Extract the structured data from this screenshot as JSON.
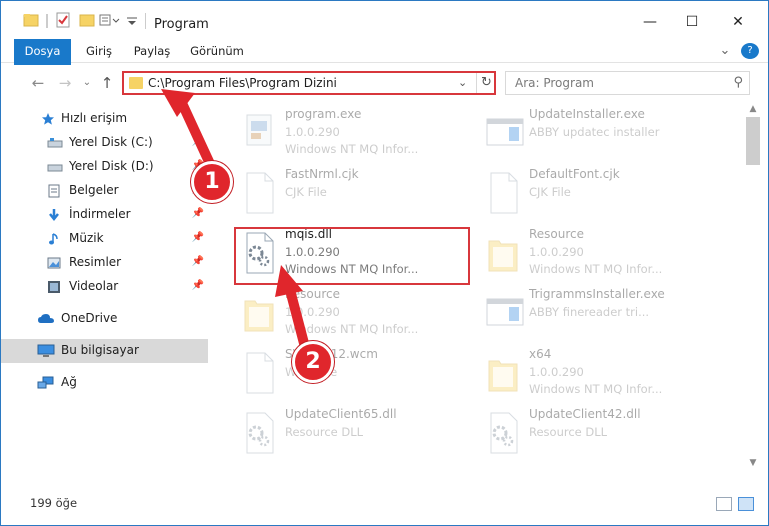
{
  "window": {
    "title": "Program",
    "controls": {
      "minimize": "—",
      "maximize": "☐",
      "close": "✕"
    }
  },
  "ribbon": {
    "tabs": [
      "Dosya",
      "Giriş",
      "Paylaş",
      "Görünüm"
    ],
    "collapse_icon": "⌄",
    "help_icon": "?"
  },
  "address": {
    "path": "C:\\Program Files\\Program Dizini",
    "search_placeholder": "Ara: Program"
  },
  "sidebar": {
    "items": [
      {
        "label": "Hızlı erişim",
        "icon": "star-icon",
        "pinned": false
      },
      {
        "label": "Yerel Disk (C:)",
        "icon": "drive-icon",
        "pinned": true
      },
      {
        "label": "Yerel Disk (D:)",
        "icon": "drive-icon",
        "pinned": true
      },
      {
        "label": "Belgeler",
        "icon": "documents-icon",
        "pinned": true
      },
      {
        "label": "İndirmeler",
        "icon": "download-icon",
        "pinned": true
      },
      {
        "label": "Müzik",
        "icon": "music-icon",
        "pinned": true
      },
      {
        "label": "Resimler",
        "icon": "pictures-icon",
        "pinned": true
      },
      {
        "label": "Videolar",
        "icon": "videos-icon",
        "pinned": true
      },
      {
        "label": "OneDrive",
        "icon": "cloud-icon",
        "pinned": false
      },
      {
        "label": "Bu bilgisayar",
        "icon": "computer-icon",
        "pinned": false
      },
      {
        "label": "Ağ",
        "icon": "network-icon",
        "pinned": false
      }
    ]
  },
  "files": [
    {
      "name": "program.exe",
      "l2": "1.0.0.290",
      "l3": "Windows NT MQ Infor...",
      "icon": "exe-icon"
    },
    {
      "name": "UpdateInstaller.exe",
      "l2": "ABBY updatec installer",
      "l3": "",
      "icon": "window-icon"
    },
    {
      "name": "FastNrml.cjk",
      "l2": "CJK File",
      "l3": "",
      "icon": "blank-file-icon"
    },
    {
      "name": "DefaultFont.cjk",
      "l2": "CJK File",
      "l3": "",
      "icon": "blank-file-icon"
    },
    {
      "name": "mqis.dll",
      "l2": "1.0.0.290",
      "l3": "Windows NT MQ Infor...",
      "icon": "dll-gear-icon"
    },
    {
      "name": "Resource",
      "l2": "1.0.0.290",
      "l3": "Windows NT MQ Infor...",
      "icon": "folder-icon"
    },
    {
      "name": "Resource",
      "l2": "1.0.0.290",
      "l3": "Windows NT MQ Infor...",
      "icon": "folder-icon"
    },
    {
      "name": "TrigrammsInstaller.exe",
      "l2": "ABBY finereader tri...",
      "l3": "",
      "icon": "window-icon"
    },
    {
      "name": "SWordP12.wcm",
      "l2": "WCM File",
      "l3": "",
      "icon": "blank-file-icon"
    },
    {
      "name": "x64",
      "l2": "1.0.0.290",
      "l3": "Windows NT MQ Infor...",
      "icon": "folder-icon"
    },
    {
      "name": "UpdateClient65.dll",
      "l2": "Resource DLL",
      "l3": "",
      "icon": "dll-gear-icon"
    },
    {
      "name": "UpdateClient42.dll",
      "l2": "Resource DLL",
      "l3": "",
      "icon": "dll-gear-icon"
    }
  ],
  "status": {
    "count": "199 öğe"
  },
  "callouts": [
    "1",
    "2"
  ],
  "colors": {
    "accent": "#1979ca",
    "highlight": "#d8373c",
    "selected": "#d9d9d9"
  }
}
